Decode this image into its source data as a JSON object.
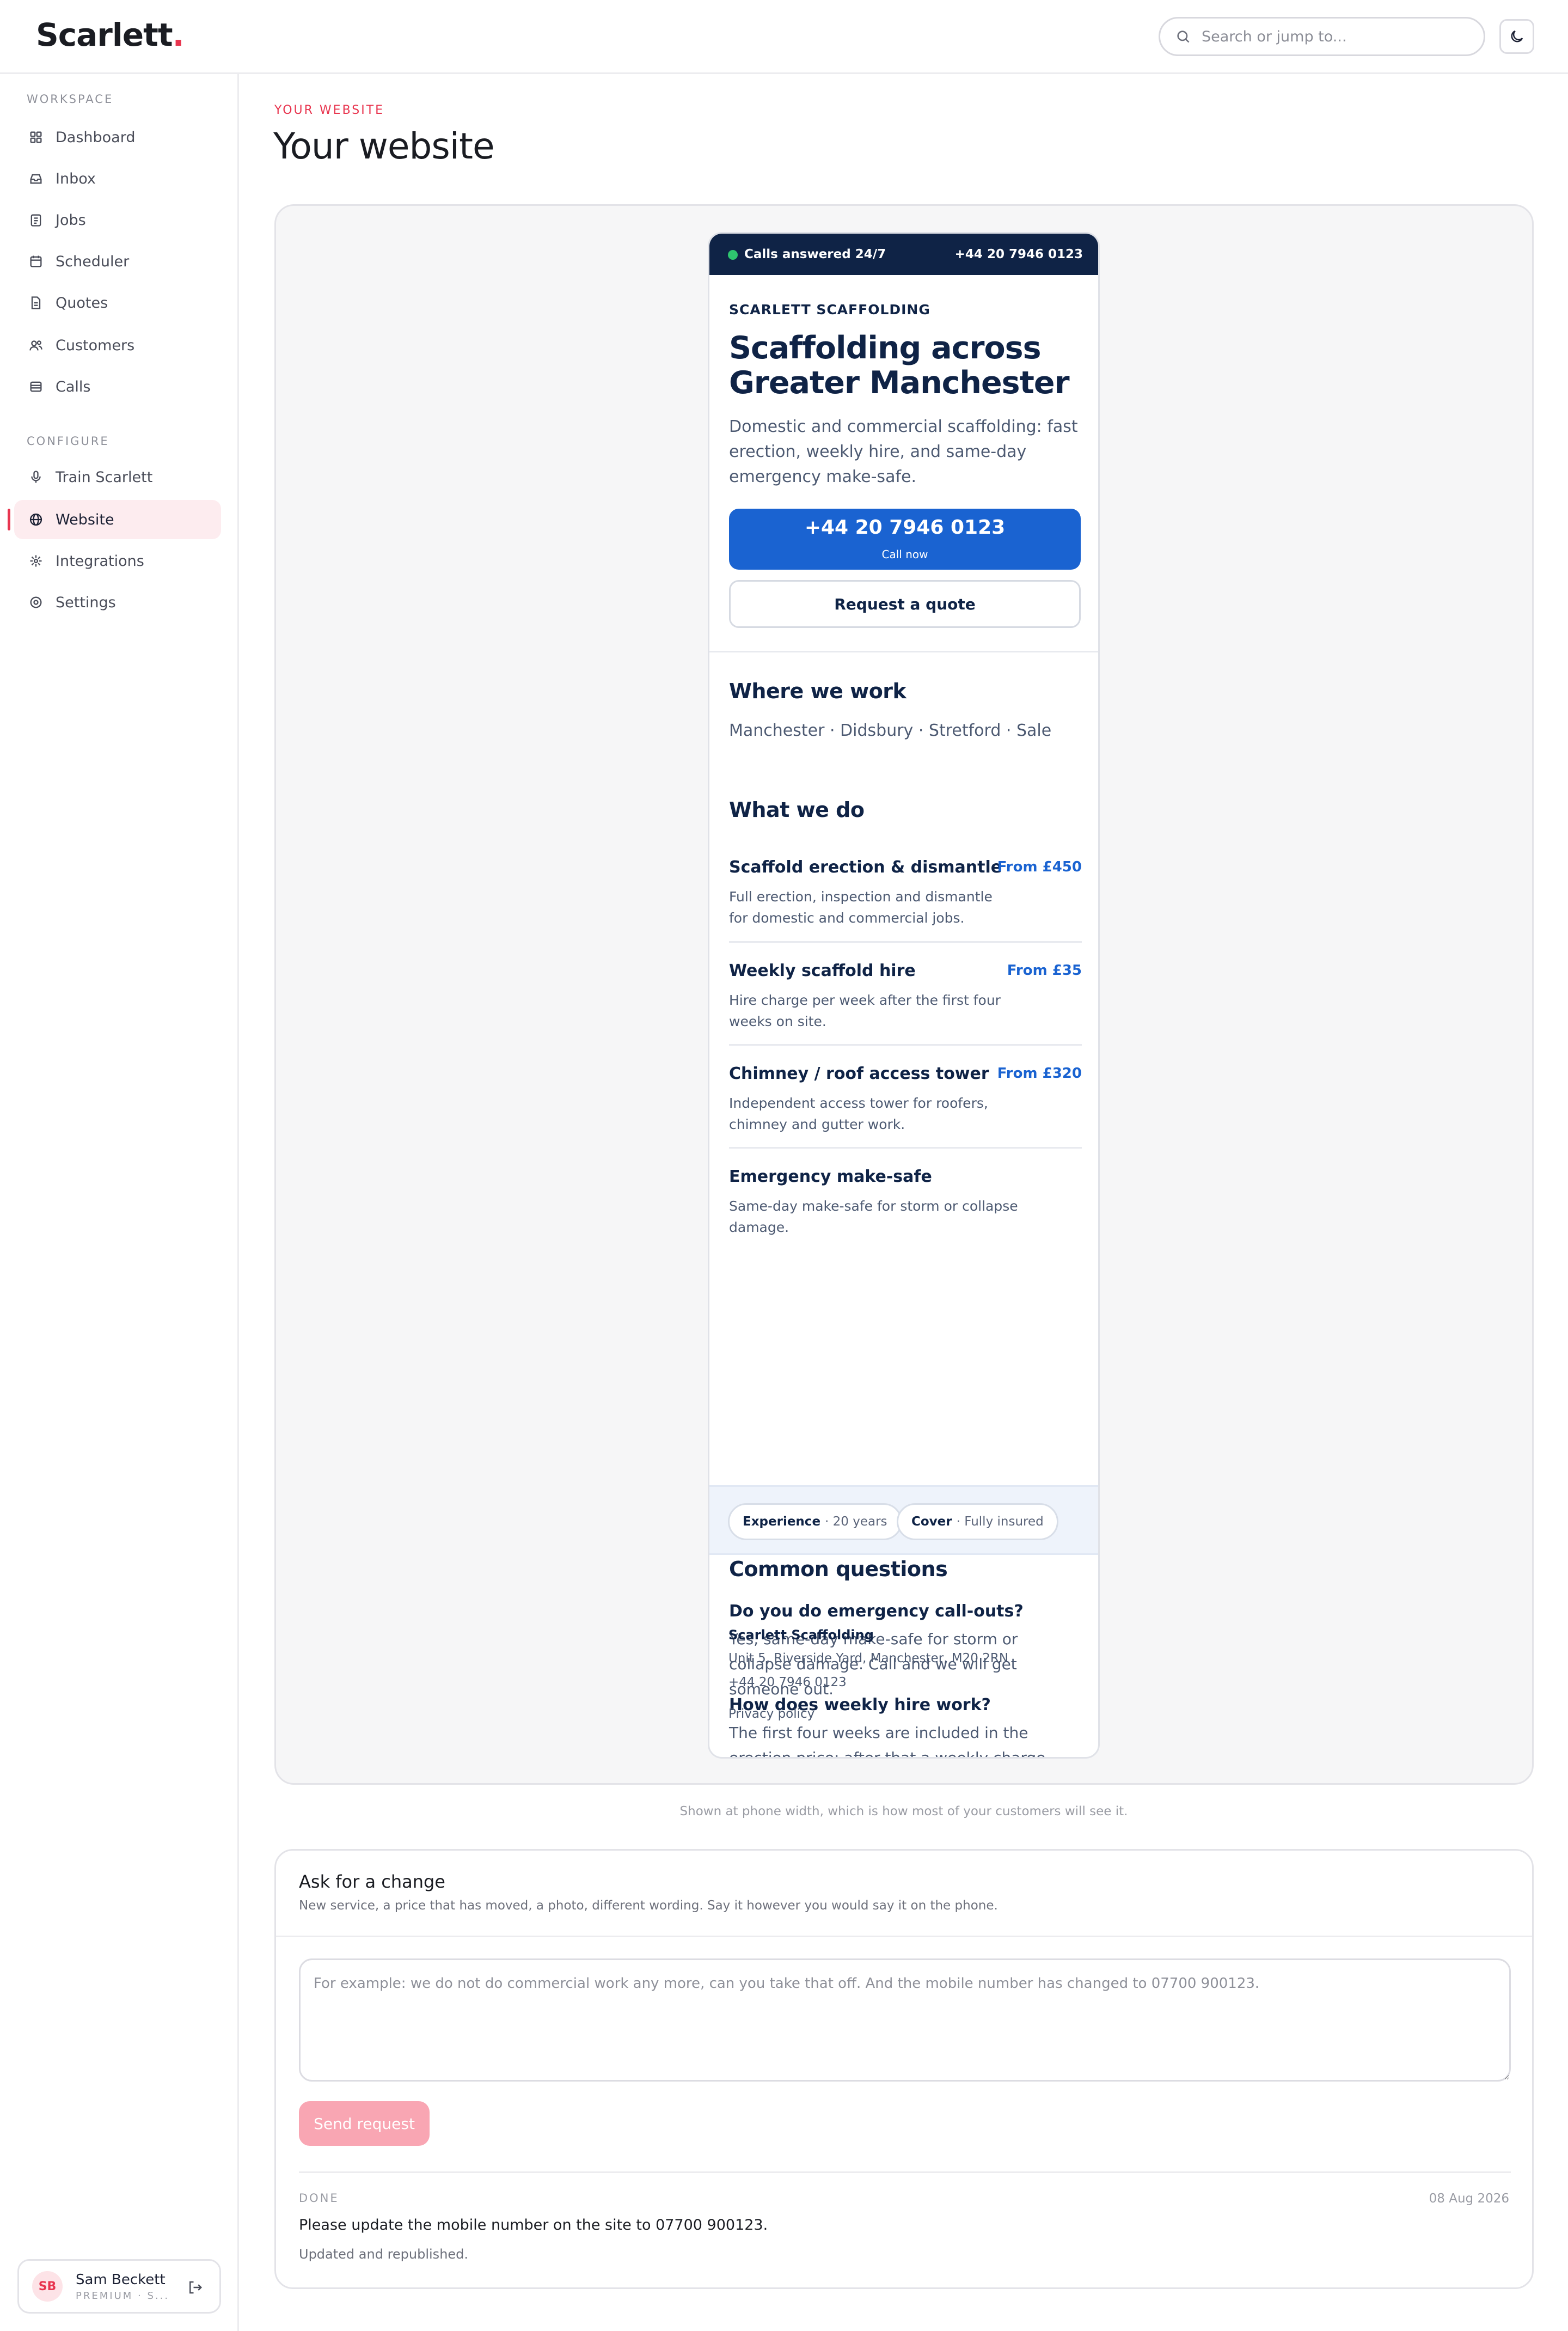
{
  "app": {
    "logo": "Scarlett",
    "logo_dot": "."
  },
  "search": {
    "placeholder": "Search or jump to..."
  },
  "sidebar": {
    "sections": [
      {
        "label": "WORKSPACE",
        "items": [
          {
            "label": "Dashboard",
            "icon": "grid-icon"
          },
          {
            "label": "Inbox",
            "icon": "inbox-icon"
          },
          {
            "label": "Jobs",
            "icon": "clipboard-icon"
          },
          {
            "label": "Scheduler",
            "icon": "calendar-icon"
          },
          {
            "label": "Quotes",
            "icon": "document-icon"
          },
          {
            "label": "Customers",
            "icon": "users-icon"
          },
          {
            "label": "Calls",
            "icon": "calls-icon"
          }
        ]
      },
      {
        "label": "CONFIGURE",
        "items": [
          {
            "label": "Train Scarlett",
            "icon": "microphone-icon"
          },
          {
            "label": "Website",
            "icon": "globe-icon",
            "active": true
          },
          {
            "label": "Integrations",
            "icon": "integrations-icon"
          },
          {
            "label": "Settings",
            "icon": "settings-icon"
          }
        ]
      }
    ],
    "user": {
      "initials": "SB",
      "name": "Sam Beckett",
      "plan": "PREMIUM · S..."
    }
  },
  "main": {
    "eyebrow": "YOUR WEBSITE",
    "title": "Your website",
    "caption": "Shown at phone width, which is how most of your customers will see it."
  },
  "site": {
    "topbar": {
      "status": "Calls answered 24/7",
      "phone": "+44 20 7946 0123"
    },
    "business": "SCARLETT SCAFFOLDING",
    "hero_title": "Scaffolding across Greater Manchester",
    "hero_sub": "Domestic and commercial scaffolding: fast erection, weekly hire, and same-day emergency make-safe.",
    "call_number": "+44 20 7946 0123",
    "call_label": "Call now",
    "quote_label": "Request a quote",
    "areas_title": "Where we work",
    "areas": "Manchester · Didsbury · Stretford · Sale",
    "services_title": "What we do",
    "services": [
      {
        "name": "Scaffold erection & dismantle",
        "price": "From £450",
        "desc": "Full erection, inspection and dismantle for domestic and commercial jobs."
      },
      {
        "name": "Weekly scaffold hire",
        "price": "From £35",
        "desc": "Hire charge per week after the first four weeks on site."
      },
      {
        "name": "Chimney / roof access tower",
        "price": "From £320",
        "desc": "Independent access tower for roofers, chimney and gutter work."
      },
      {
        "name": "Emergency make-safe",
        "price": "",
        "desc": "Same-day make-safe for storm or collapse damage."
      }
    ],
    "badges": [
      {
        "label": "Experience",
        "value": "· 20 years"
      },
      {
        "label": "Cover",
        "value": "· Fully insured"
      }
    ],
    "faq_title": "Common questions",
    "faqs": [
      {
        "q": "Do you do emergency call-outs?",
        "a": "Yes, same-day make-safe for storm or collapse damage. Call and we will get someone out."
      },
      {
        "q": "How does weekly hire work?",
        "a": "The first four weeks are included in the erection price; after that a weekly charge applies until we collect."
      }
    ],
    "footer": {
      "name": "Scarlett Scaffolding",
      "address": "Unit 5, Riverside Yard, Manchester, M20 2RN",
      "phone": "+44 20 7946 0123",
      "privacy": "Privacy policy"
    }
  },
  "change": {
    "title": "Ask for a change",
    "subtitle": "New service, a price that has moved, a photo, different wording. Say it however you would say it on the phone.",
    "placeholder": "For example: we do not do commercial work any more, can you take that off. And the mobile number has changed to 07700 900123.",
    "send_label": "Send request",
    "history": [
      {
        "status": "DONE",
        "date": "08 Aug 2026",
        "text": "Please update the mobile number on the site to 07700 900123.",
        "result": "Updated and republished."
      }
    ]
  },
  "colors": {
    "accent": "#e8354f",
    "navy": "#0f2346",
    "blue": "#1a63d1",
    "live": "#2ec56f"
  }
}
